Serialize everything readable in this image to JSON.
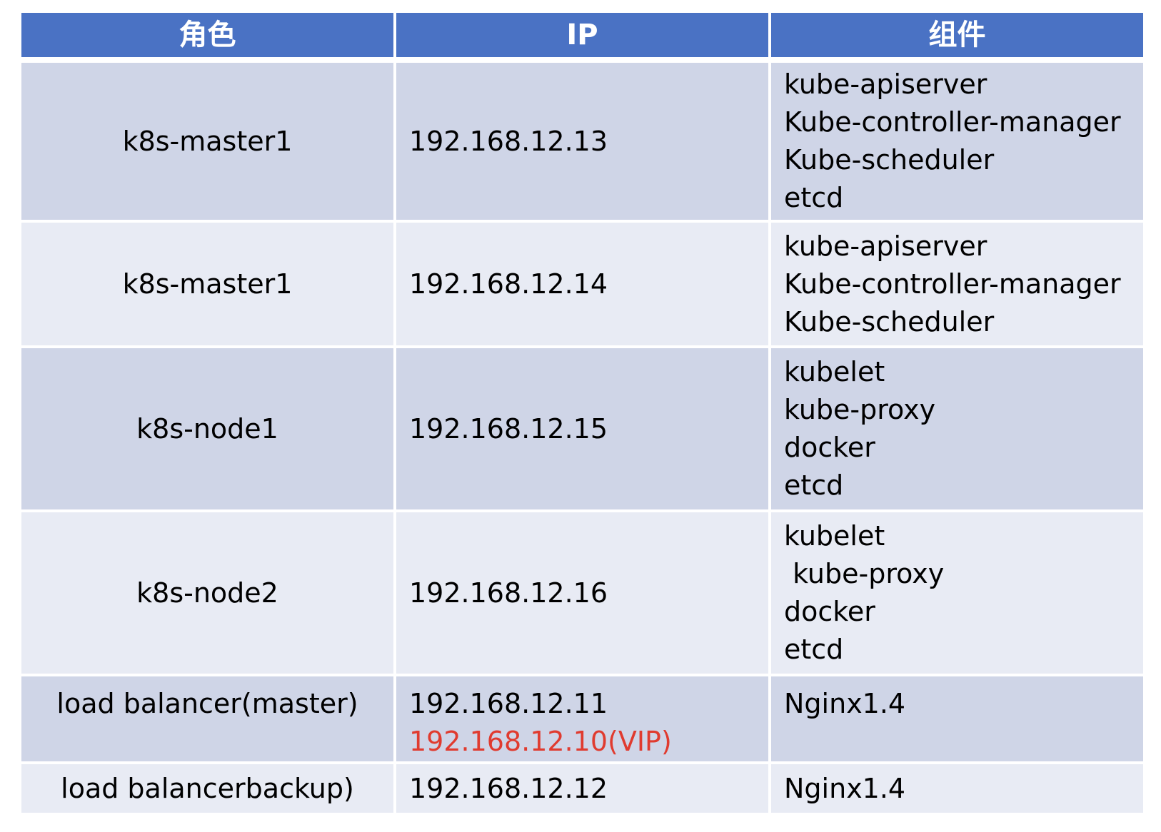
{
  "headers": [
    "角色",
    "IP",
    "组件"
  ],
  "rows": [
    {
      "role": "k8s-master1",
      "ip": [
        "192.168.12.13"
      ],
      "components": [
        "kube-apiserver",
        "Kube-controller-manager",
        "Kube-scheduler",
        "etcd"
      ]
    },
    {
      "role": "k8s-master1",
      "ip": [
        "192.168.12.14"
      ],
      "components": [
        "kube-apiserver",
        "Kube-controller-manager",
        "Kube-scheduler"
      ]
    },
    {
      "role": "k8s-node1",
      "ip": [
        "192.168.12.15"
      ],
      "components": [
        "kubelet",
        "kube-proxy",
        "docker",
        "etcd"
      ]
    },
    {
      "role": "k8s-node2",
      "ip": [
        "192.168.12.16"
      ],
      "components": [
        "kubelet",
        " kube-proxy",
        "docker",
        "etcd"
      ]
    },
    {
      "role": "load balancer(master)",
      "ip": [
        "192.168.12.11",
        "192.168.12.10(VIP)"
      ],
      "components": [
        "Nginx1.4"
      ]
    },
    {
      "role": "load balancerbackup)",
      "ip": [
        "192.168.12.12"
      ],
      "components": [
        "Nginx1.4"
      ]
    }
  ],
  "colors": {
    "header_bg": "#4a72c4",
    "row_odd": "#cfd5e7",
    "row_even": "#e8ebf4",
    "vip_text": "#e03b2f"
  }
}
